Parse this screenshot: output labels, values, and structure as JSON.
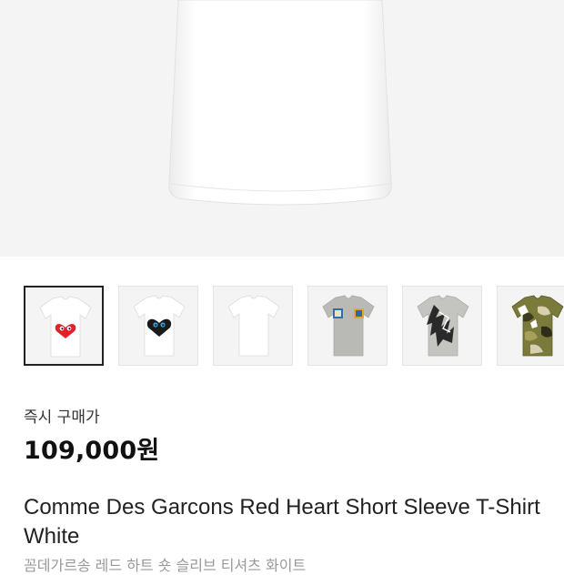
{
  "product": {
    "price_label": "즉시 구매가",
    "price": "109,000원",
    "title": "Comme Des Garcons Red Heart Short Sleeve T-Shirt White",
    "subtitle_ko": "꼼데가르송 레드 하트 숏 슬리브 티셔츠 화이트"
  },
  "thumbnails": [
    {
      "name": "red-heart-white-tee",
      "selected": true
    },
    {
      "name": "black-heart-white-tee",
      "selected": false
    },
    {
      "name": "plain-white-tee",
      "selected": false
    },
    {
      "name": "grey-print-tee",
      "selected": false
    },
    {
      "name": "grey-graphic-tee",
      "selected": false
    },
    {
      "name": "camo-tee",
      "selected": false
    }
  ],
  "colors": {
    "heart_red": "#e0202a",
    "heart_black": "#1a1a1a",
    "eye_blue": "#3aa0e0",
    "hero_bg": "#f4f4f4",
    "price_text": "#111111",
    "subtitle_text": "#999999"
  }
}
